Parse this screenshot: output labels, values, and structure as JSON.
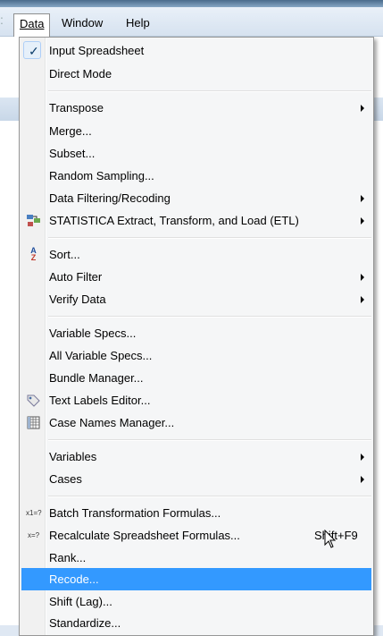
{
  "menubar": {
    "items": [
      {
        "label": "Data",
        "active": true
      },
      {
        "label": "Window",
        "active": false
      },
      {
        "label": "Help",
        "active": false
      }
    ]
  },
  "menu": {
    "items": [
      {
        "label": "Input Spreadsheet",
        "checked": true
      },
      {
        "label": "Direct Mode"
      },
      {
        "label": "Transpose",
        "submenu": true
      },
      {
        "label": "Merge..."
      },
      {
        "label": "Subset..."
      },
      {
        "label": "Random Sampling..."
      },
      {
        "label": "Data Filtering/Recoding",
        "submenu": true
      },
      {
        "label": "STATISTICA Extract, Transform, and Load (ETL)",
        "submenu": true,
        "icon": "etl-icon"
      },
      {
        "label": "Sort...",
        "icon": "sort-az-icon"
      },
      {
        "label": "Auto Filter",
        "submenu": true
      },
      {
        "label": "Verify Data",
        "submenu": true
      },
      {
        "label": "Variable Specs..."
      },
      {
        "label": "All Variable Specs..."
      },
      {
        "label": "Bundle Manager..."
      },
      {
        "label": "Text Labels Editor...",
        "icon": "tag-icon"
      },
      {
        "label": "Case Names Manager...",
        "icon": "grid-icon"
      },
      {
        "label": "Variables",
        "submenu": true
      },
      {
        "label": "Cases",
        "submenu": true
      },
      {
        "label": "Batch Transformation Formulas...",
        "icon": "formula-batch-icon"
      },
      {
        "label": "Recalculate Spreadsheet Formulas...",
        "shortcut": "Shift+F9",
        "icon": "formula-icon"
      },
      {
        "label": "Rank..."
      },
      {
        "label": "Recode...",
        "highlighted": true
      },
      {
        "label": "Shift (Lag)..."
      },
      {
        "label": "Standardize..."
      }
    ]
  },
  "icons": {
    "sort_glyph_top": "A",
    "sort_glyph_bottom": "Z",
    "batch_formula": "x1=?",
    "formula": "x=?"
  },
  "colors": {
    "highlight": "#3399ff",
    "menu_bg": "#f5f6f7"
  }
}
